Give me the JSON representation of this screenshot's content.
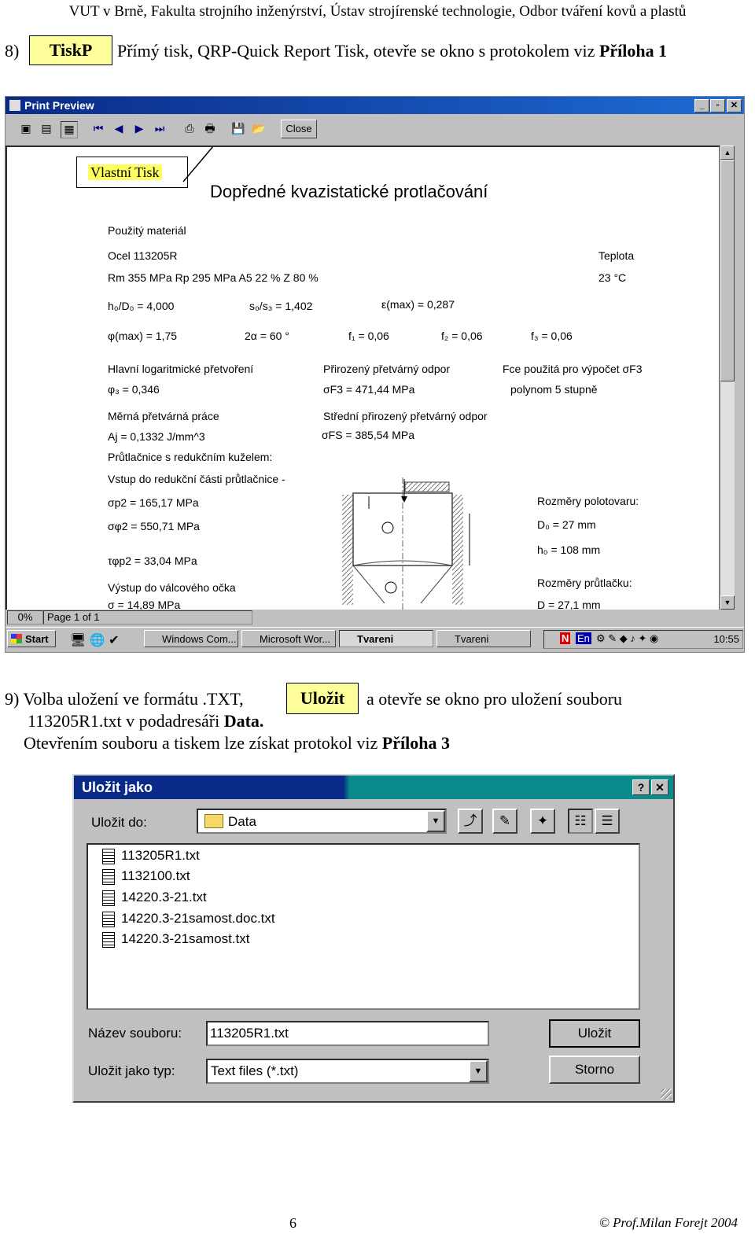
{
  "header": {
    "text": "VUT v Brně, Fakulta strojního inženýrství, Ústav strojírenské technologie, Odbor tváření kovů a plastů"
  },
  "step8": {
    "number": "8)",
    "button": "TiskP",
    "text_before": "Přímý tisk, QRP-Quick Report Tisk, otevře se okno s protokolem viz ",
    "text_bold": "Příloha 1"
  },
  "preview": {
    "title": "Print Preview",
    "close_label": "Close",
    "callout": "Vlastní Tisk",
    "status_zoom": "0%",
    "status_page": "Page 1 of 1",
    "doc": {
      "title": "Dopředné kvazistatické protlačování",
      "material_label": "Použitý materiál",
      "steel": "Ocel     113205R",
      "temp_label": "Teplota",
      "props": "Rm 355      MPa        Rp 295      MPa          A5   22        %                   Z 80           %",
      "temp_value": "23 °C",
      "h0d0": "h₀/D₀ = 4,000",
      "s0s3": "s₀/s₃ = 1,402",
      "emax": "ε(max) = 0,287",
      "phimax": "φ(max) = 1,75",
      "alpha": "2α = 60 °",
      "f1": "f₁ = 0,06",
      "f2": "f₂ = 0,06",
      "f3": "f₃ = 0,06",
      "log_label": "Hlavní logaritmické přetvoření",
      "phi3": "φ₃ = 0,346",
      "nat_label": "Přirozený přetvárný odpor",
      "sigF3": "σF3 = 471,44 MPa",
      "fce_label": "Fce použitá pro výpočet  σF3",
      "poly": "polynom 5 stupně",
      "work_label": "Měrná přetvárná práce",
      "aj": "Aj = 0,1332 J/mm^3",
      "mean_label": "Střední přirozený přetvárný odpor",
      "sigFS": "σFS = 385,54 MPa",
      "die_label": "Průtlačnice s redukčním kuželem:",
      "entry_label": "Vstup do redukční části průtlačnice -",
      "sig_p2": "σp2 = 165,17 MPa",
      "sig_phi2": "σφ2 = 550,71 MPa",
      "tau": "τφp2 = 33,04 MPa",
      "exit_label": "Výstup do válcového očka",
      "exit_val": "σ = 14,89 MPa",
      "blank_label": "Rozměry polotovaru:",
      "d0": "D₀ = 27 mm",
      "h0": "h₀ = 108 mm",
      "punch_label": "Rozměry průtlačku:",
      "punch_val": "D  = 27,1 mm"
    },
    "taskbar": {
      "start": "Start",
      "tasks": [
        "Windows Com...",
        "Microsoft Wor...",
        "Tvareni",
        "Tvareni"
      ],
      "tray_letters": [
        "N",
        "En"
      ],
      "clock": "10:55"
    }
  },
  "step9": {
    "line1_a": "9) Volba uložení ve formátu .TXT,",
    "button": "Uložit",
    "line1_b": "a otevře se okno pro uložení souboru",
    "line2_a": "113205R1.txt v podadresáři ",
    "line2_b": "Data.",
    "line3_a": "Otevřením souboru a tiskem lze získat protokol viz ",
    "line3_b": "Příloha 3"
  },
  "dialog": {
    "title": "Uložit jako",
    "save_in_label": "Uložit do:",
    "folder": "Data",
    "files": [
      "113205R1.txt",
      "1132100.txt",
      "14220.3-21.txt",
      "14220.3-21samost.doc.txt",
      "14220.3-21samost.txt"
    ],
    "filename_label": "Název souboru:",
    "filename_value": "113205R1.txt",
    "type_label": "Uložit jako typ:",
    "type_value": "Text files (*.txt)",
    "save_button": "Uložit",
    "cancel_button": "Storno"
  },
  "footer": {
    "page": "6",
    "author": "© Prof.Milan Forejt 2004"
  }
}
